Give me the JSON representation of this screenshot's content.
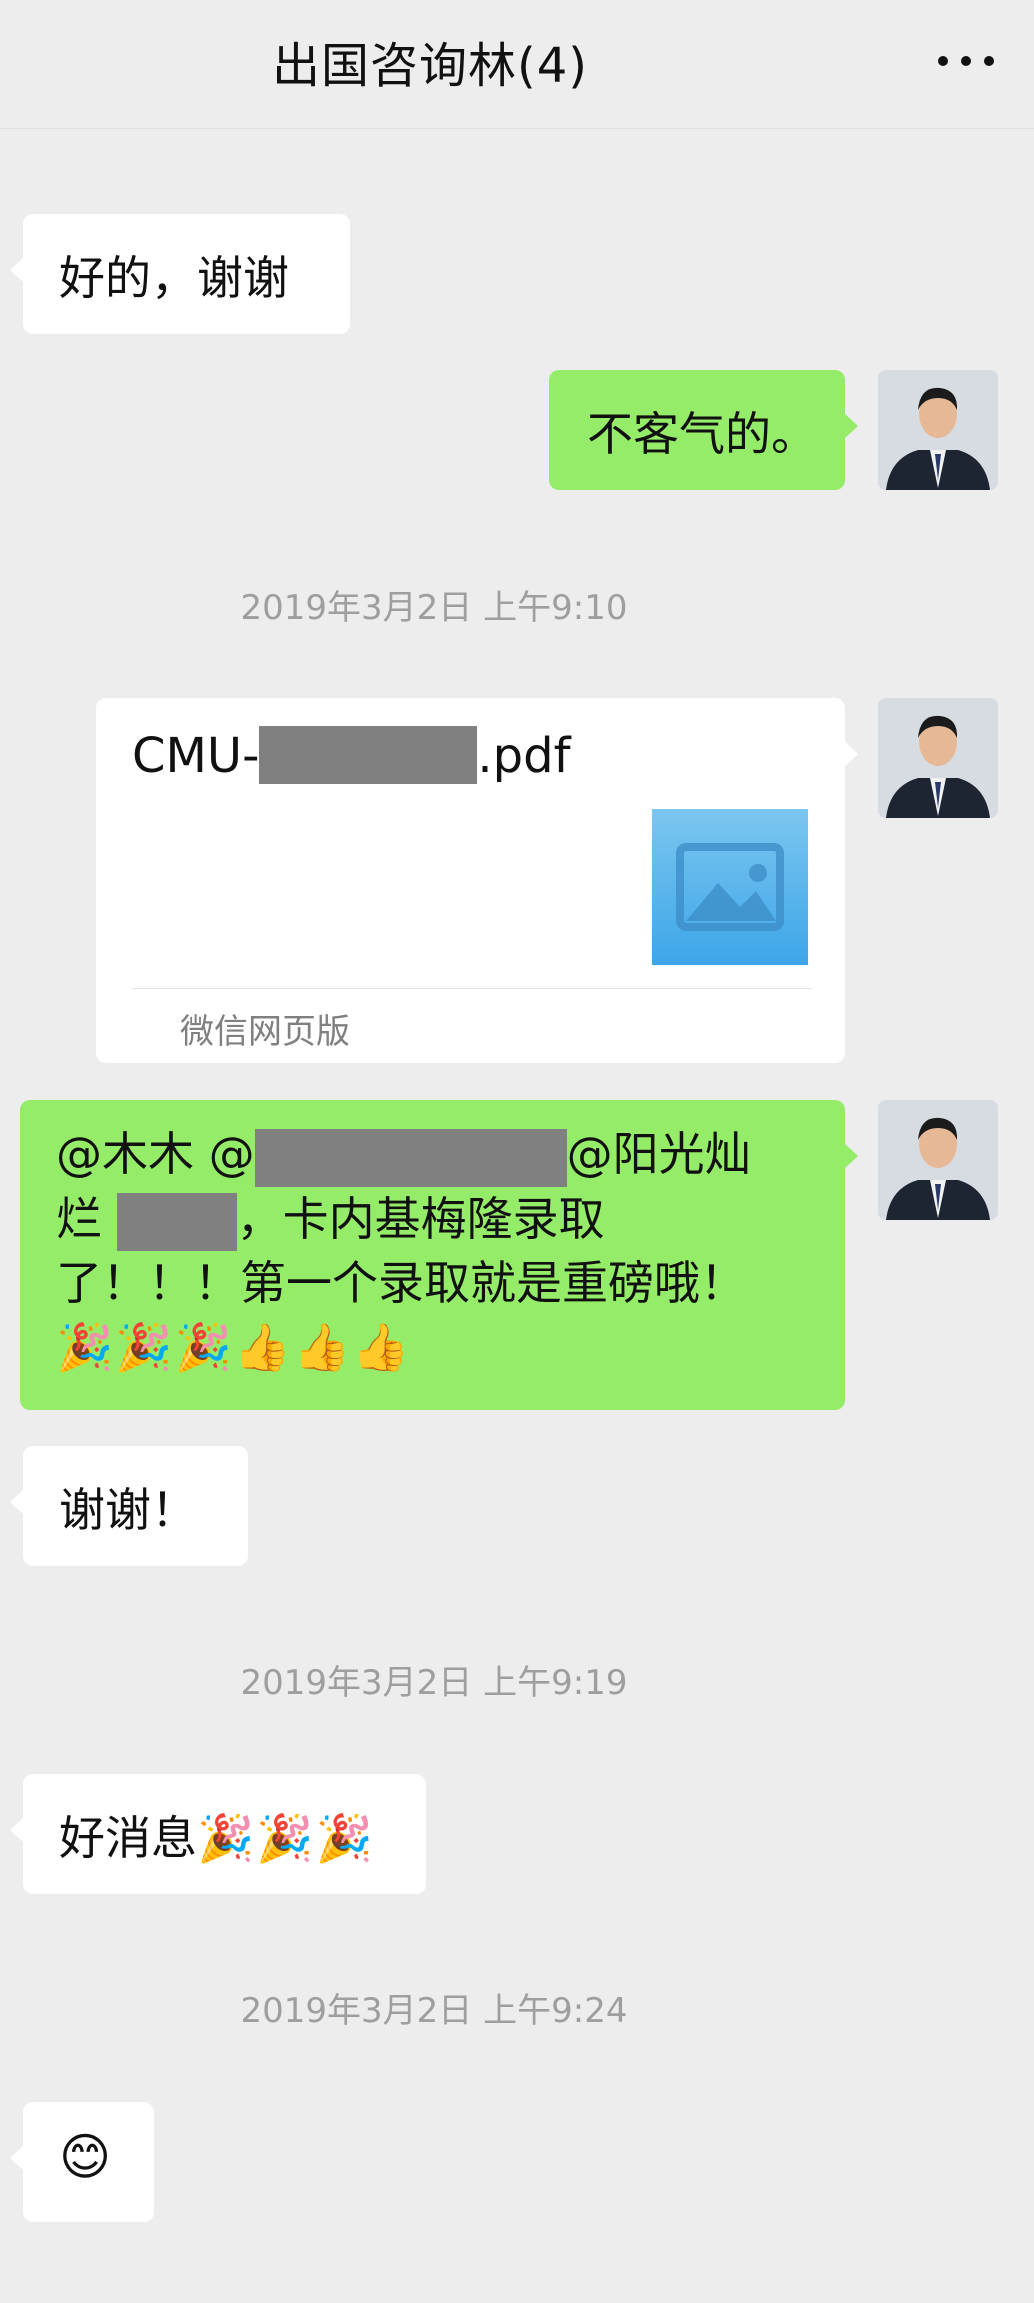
{
  "header": {
    "title": "出国咨询林(4)",
    "more_icon": "more-dots-icon"
  },
  "messages": {
    "m1": {
      "text": "好的，谢谢"
    },
    "m2": {
      "text": "不客气的。"
    },
    "time1": {
      "text": "2019年3月2日 上午9:10"
    },
    "file": {
      "name_prefix": "CMU-",
      "name_suffix": ".pdf",
      "source": "微信网页版",
      "thumbnail_icon": "image-placeholder-icon"
    },
    "m4": {
      "line1_a": "@木木  @",
      "line1_b": "@阳光灿",
      "line2_a": "烂 ",
      "line2_b": "，卡内基梅隆录取",
      "line3": "了！！！第一个录取就是重磅哦！",
      "emojis": "🎉🎉🎉👍👍👍"
    },
    "m5": {
      "text": "谢谢！"
    },
    "time2": {
      "text": "2019年3月2日 上午9:19"
    },
    "m6": {
      "text": "好消息",
      "emojis": "🎉🎉🎉"
    },
    "time3": {
      "text": "2019年3月2日 上午9:24"
    },
    "m7": {
      "emoji": "😊"
    }
  },
  "colors": {
    "background": "#ededed",
    "sent_bubble": "#95ec69",
    "received_bubble": "#ffffff",
    "timestamp": "#9e9e9e"
  }
}
